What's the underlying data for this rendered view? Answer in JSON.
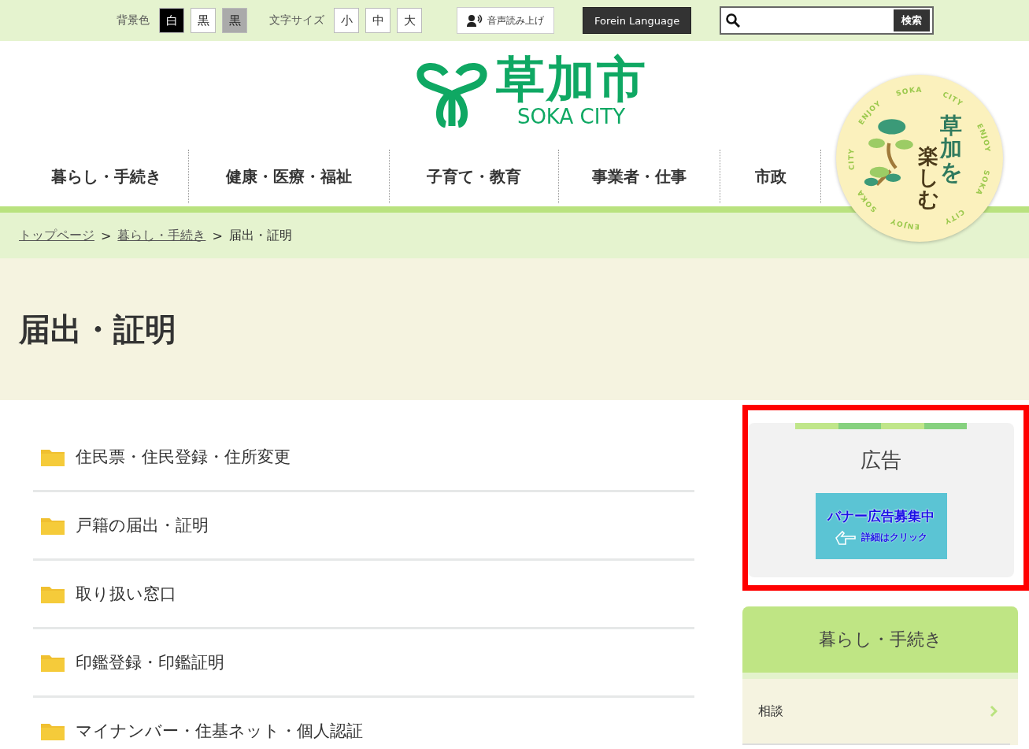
{
  "top_bar": {
    "bg_label": "背景色",
    "bg_options": [
      {
        "label": "白",
        "color": "#000000"
      },
      {
        "label": "黒",
        "color": "#ffffff"
      },
      {
        "label": "黒",
        "color": "#aaaaaa"
      }
    ],
    "size_label": "文字サイズ",
    "size_options": [
      "小",
      "中",
      "大"
    ],
    "read_aloud": "音声読み上げ",
    "language": "Forein Language",
    "search": {
      "button": "検索"
    }
  },
  "logo": {
    "title": "草加市",
    "subtitle": "SOKA CITY"
  },
  "badge": {
    "ring": [
      "ENJOY",
      "SOKA",
      "CITY",
      "ENJOY",
      "SOKA",
      "CITY",
      "ENJOY",
      "SOKA",
      "CITY"
    ],
    "columns": [
      "草加を",
      "楽しむ"
    ]
  },
  "nav": [
    "暮らし・手続き",
    "健康・医療・福祉",
    "子育て・教育",
    "事業者・仕事",
    "市政"
  ],
  "breadcrumb": {
    "links": [
      "トップページ",
      "暮らし・手続き"
    ],
    "current": "届出・証明",
    "separator": ">"
  },
  "page_title": "届出・証明",
  "categories": [
    "住民票・住民登録・住所変更",
    "戸籍の届出・証明",
    "取り扱い窓口",
    "印鑑登録・印鑑証明",
    "マイナンバー・住基ネット・個人認証"
  ],
  "ad": {
    "title": "広告",
    "banner_main": "バナー広告募集中",
    "banner_sub": "詳細はクリック"
  },
  "side_menu": {
    "title": "暮らし・手続き",
    "items": [
      "相談"
    ]
  }
}
